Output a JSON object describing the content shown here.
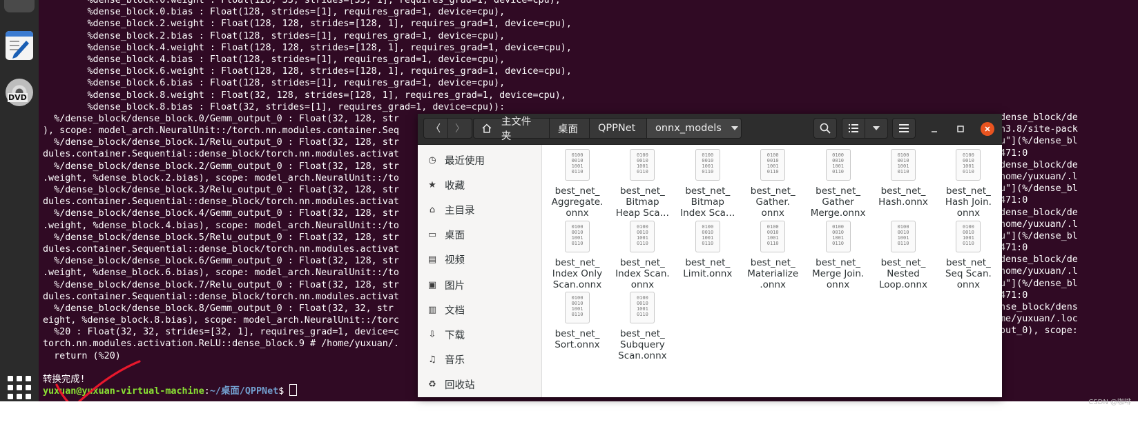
{
  "terminal": {
    "lines": [
      "        %dense_block.0.weight : Float(128, 33, strides=[33, 1], requires_grad=1, device=cpu),",
      "        %dense_block.0.bias : Float(128, strides=[1], requires_grad=1, device=cpu),",
      "        %dense_block.2.weight : Float(128, 128, strides=[128, 1], requires_grad=1, device=cpu),",
      "        %dense_block.2.bias : Float(128, strides=[1], requires_grad=1, device=cpu),",
      "        %dense_block.4.weight : Float(128, 128, strides=[128, 1], requires_grad=1, device=cpu),",
      "        %dense_block.4.bias : Float(128, strides=[1], requires_grad=1, device=cpu),",
      "        %dense_block.6.weight : Float(128, 128, strides=[128, 1], requires_grad=1, device=cpu),",
      "        %dense_block.6.bias : Float(128, strides=[1], requires_grad=1, device=cpu),",
      "        %dense_block.8.weight : Float(32, 128, strides=[128, 1], requires_grad=1, device=cpu),",
      "        %dense_block.8.bias : Float(32, strides=[1], requires_grad=1, device=cpu)):",
      "  %/dense_block/dense_block.0/Gemm_output_0 : Float(32, 128, str",
      "), scope: model_arch.NeuralUnit::/torch.nn.modules.container.Seq",
      "  %/dense_block/dense_block.1/Relu_output_0 : Float(32, 128, str",
      "dules.container.Sequential::dense_block/torch.nn.modules.activat",
      "  %/dense_block/dense_block.2/Gemm_output_0 : Float(32, 128, str",
      ".weight, %dense_block.2.bias), scope: model_arch.NeuralUnit::/to",
      "  %/dense_block/dense_block.3/Relu_output_0 : Float(32, 128, str",
      "dules.container.Sequential::dense_block/torch.nn.modules.activat",
      "  %/dense_block/dense_block.4/Gemm_output_0 : Float(32, 128, str",
      ".weight, %dense_block.4.bias), scope: model_arch.NeuralUnit::/to",
      "  %/dense_block/dense_block.5/Relu_output_0 : Float(32, 128, str",
      "dules.container.Sequential::dense_block/torch.nn.modules.activat",
      "  %/dense_block/dense_block.6/Gemm_output_0 : Float(32, 128, str",
      ".weight, %dense_block.6.bias), scope: model_arch.NeuralUnit::/to",
      "  %/dense_block/dense_block.7/Relu_output_0 : Float(32, 128, str",
      "dules.container.Sequential::dense_block/torch.nn.modules.activat",
      "  %/dense_block/dense_block.8/Gemm_output_0 : Float(32, 32, str",
      "eight, %dense_block.8.bias), scope: model_arch.NeuralUnit::/torc",
      "  %20 : Float(32, 32, strides=[32, 1], requires_grad=1, device=c",
      "torch.nn.modules.activation.ReLU::dense_block.9 # /home/yuxuan/.",
      "  return (%20)",
      "",
      "转换完成!"
    ],
    "right_lines": [
      "dense_block/de",
      "n3.8/site-pack",
      "u\"](%/dense_bl",
      "471:0",
      "dense_block/de",
      "home/yuxuan/.l",
      "u\"](%/dense_bl",
      "471:0",
      "dense_block/de",
      "home/yuxuan/.l",
      "u\"](%/dense_bl",
      "471:0",
      "dense_block/de",
      "home/yuxuan/.l",
      "u\"](%/dense_bl",
      "471:0",
      "nse_block/dens",
      "me/yuxuan/.loc",
      "out_0), scope:",
      ""
    ],
    "prompt_user": "yuxuan@yuxuan-virtual-machine",
    "prompt_colon": ":",
    "prompt_path": "~/桌面/QPPNet",
    "prompt_symbol": "$ "
  },
  "file_manager": {
    "breadcrumbs": {
      "home": "主文件夹",
      "desktop": "桌面",
      "qppnet": "QPPNet",
      "current": "onnx_models"
    },
    "sidebar": [
      {
        "label": "最近使用",
        "icon": "clock-icon"
      },
      {
        "label": "收藏",
        "icon": "star-icon"
      },
      {
        "label": "主目录",
        "icon": "home-icon"
      },
      {
        "label": "桌面",
        "icon": "desktop-icon"
      },
      {
        "label": "视频",
        "icon": "video-icon"
      },
      {
        "label": "图片",
        "icon": "image-icon"
      },
      {
        "label": "文档",
        "icon": "document-icon"
      },
      {
        "label": "下载",
        "icon": "download-icon"
      },
      {
        "label": "音乐",
        "icon": "music-icon"
      },
      {
        "label": "回收站",
        "icon": "trash-icon"
      }
    ],
    "files": [
      "best_net_\nAggregate.\nonnx",
      "best_net_\nBitmap\nHeap Sca…",
      "best_net_\nBitmap\nIndex Sca…",
      "best_net_\nGather.\nonnx",
      "best_net_\nGather\nMerge.onnx",
      "best_net_\nHash.onnx",
      "best_net_\nHash Join.\nonnx",
      "best_net_\nIndex Only\nScan.onnx",
      "best_net_\nIndex Scan.\nonnx",
      "best_net_\nLimit.onnx",
      "best_net_\nMaterialize\n.onnx",
      "best_net_\nMerge Join.\nonnx",
      "best_net_\nNested\nLoop.onnx",
      "best_net_\nSeq Scan.\nonnx",
      "best_net_\nSort.onnx",
      "best_net_\nSubquery\nScan.onnx"
    ],
    "binary_icon_text": "0100\n0010\n1001\n0110"
  },
  "dock": {
    "dvd_label": "DVD"
  },
  "watermark": "CSDN @咖啡"
}
